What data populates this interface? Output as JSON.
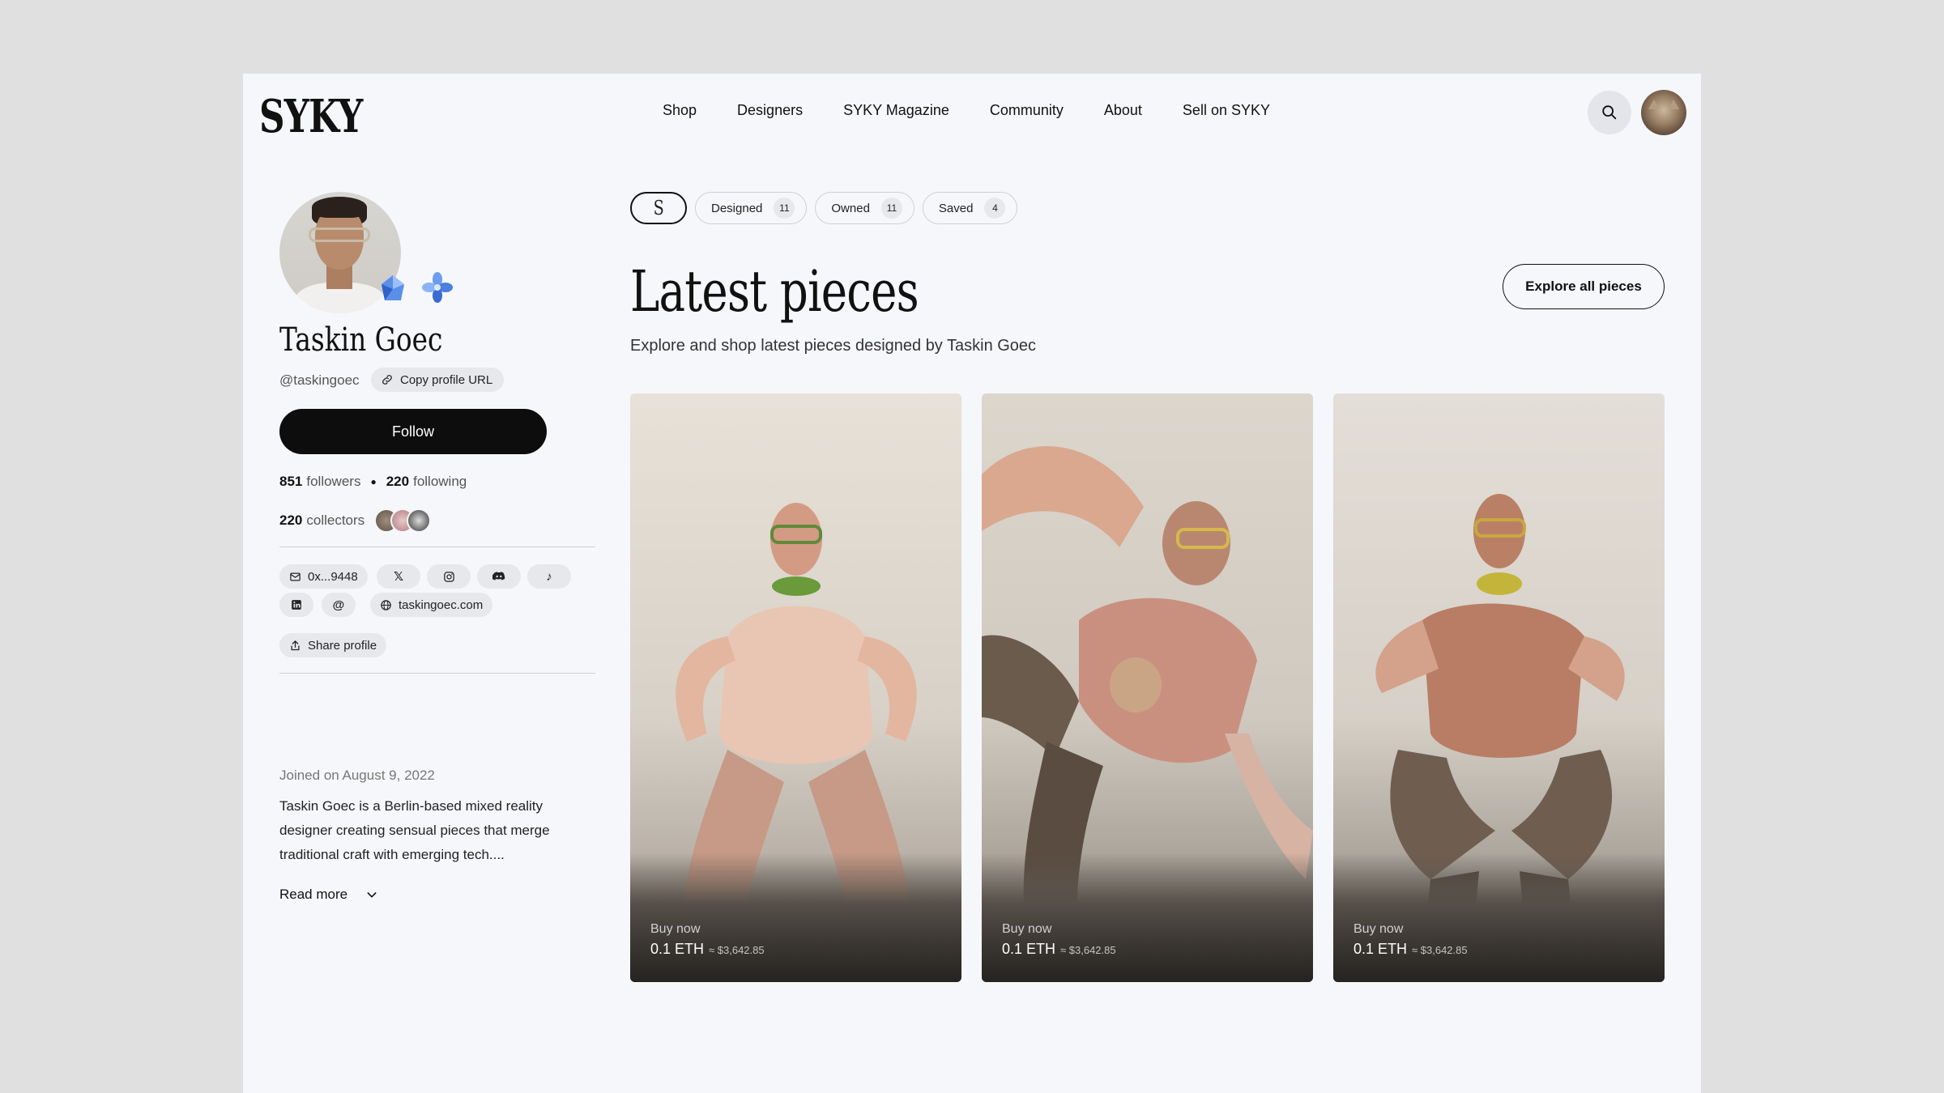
{
  "header": {
    "logo": "SYKY",
    "nav": [
      "Shop",
      "Designers",
      "SYKY Magazine",
      "Community",
      "About",
      "Sell on SYKY"
    ]
  },
  "profile": {
    "name": "Taskin Goec",
    "handle": "@taskingoec",
    "copy_url_label": "Copy profile URL",
    "follow_label": "Follow",
    "followers_count": "851",
    "followers_label": "followers",
    "following_count": "220",
    "following_label": "following",
    "collectors_count": "220",
    "collectors_label": "collectors",
    "wallet": "0x...9448",
    "website": "taskingoec.com",
    "share_label": "Share profile",
    "joined": "Joined on August 9, 2022",
    "bio": "Taskin Goec is a Berlin-based mixed reality designer creating sensual pieces that merge traditional craft with emerging tech....",
    "read_more": "Read more"
  },
  "tabs": {
    "logo": "S",
    "items": [
      {
        "label": "Designed",
        "count": "11"
      },
      {
        "label": "Owned",
        "count": "11"
      },
      {
        "label": "Saved",
        "count": "4"
      }
    ]
  },
  "main": {
    "title": "Latest pieces",
    "subtitle": "Explore and shop latest pieces designed by Taskin Goec",
    "explore_label": "Explore all pieces"
  },
  "cards": [
    {
      "buy_label": "Buy now",
      "price": "0.1 ETH",
      "usd": "≈ $3,642.85"
    },
    {
      "buy_label": "Buy now",
      "price": "0.1 ETH",
      "usd": "≈ $3,642.85"
    },
    {
      "buy_label": "Buy now",
      "price": "0.1 ETH",
      "usd": "≈ $3,642.85"
    }
  ],
  "colors": {
    "page_bg": "#e0e0e1",
    "window_bg": "#f6f7fa",
    "primary": "#0d0d0e",
    "chip_bg": "#e6e8ec"
  },
  "icons": [
    "search-icon",
    "link-icon",
    "mail-icon",
    "x-icon",
    "instagram-icon",
    "discord-icon",
    "tiktok-icon",
    "linkedin-icon",
    "threads-icon",
    "globe-icon",
    "share-icon",
    "chevron-down-icon"
  ]
}
